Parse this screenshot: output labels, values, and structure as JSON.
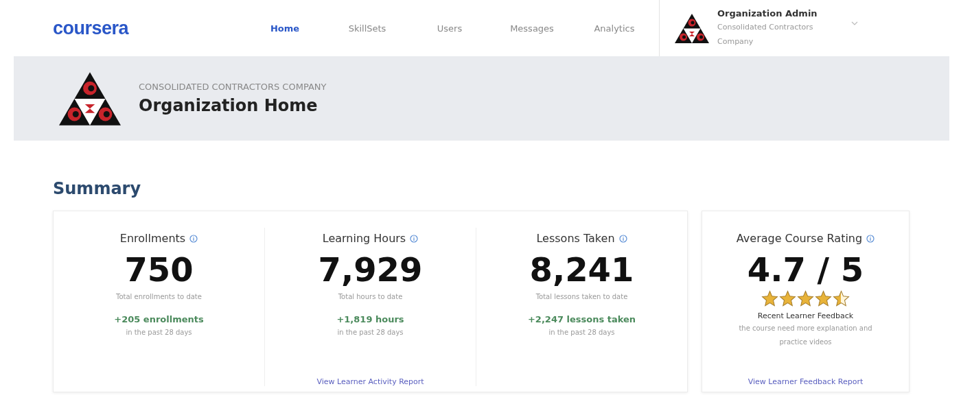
{
  "brand": {
    "logo_text": "coursera"
  },
  "nav": [
    {
      "label": "Home",
      "selected": true
    },
    {
      "label": "SkillSets",
      "selected": false
    },
    {
      "label": "Users",
      "selected": false
    },
    {
      "label": "Messages",
      "selected": false
    },
    {
      "label": "Analytics",
      "selected": false
    }
  ],
  "account": {
    "role": "Organization Admin",
    "organization": "Consolidated Contractors Company"
  },
  "banner": {
    "overline": "CONSOLIDATED CONTRACTORS COMPANY",
    "title": "Organization Home"
  },
  "summary": {
    "title": "Summary",
    "metrics": [
      {
        "label": "Enrollments",
        "value": "750",
        "caption": "Total enrollments to date",
        "delta": "+205 enrollments",
        "period": "in the past 28 days"
      },
      {
        "label": "Learning Hours",
        "value": "7,929",
        "caption": "Total hours to date",
        "delta": "+1,819 hours",
        "period": "in the past 28 days",
        "link": "View Learner Activity Report"
      },
      {
        "label": "Lessons Taken",
        "value": "8,241",
        "caption": "Total lessons taken to date",
        "delta": "+2,247 lessons taken",
        "period": "in the past 28 days"
      }
    ],
    "rating": {
      "label": "Average Course Rating",
      "value": "4.7 / 5",
      "stars": 4.5,
      "feedback_title": "Recent Learner Feedback",
      "feedback": "the course need more explanation and practice videos",
      "link": "View Learner Feedback Report"
    }
  }
}
